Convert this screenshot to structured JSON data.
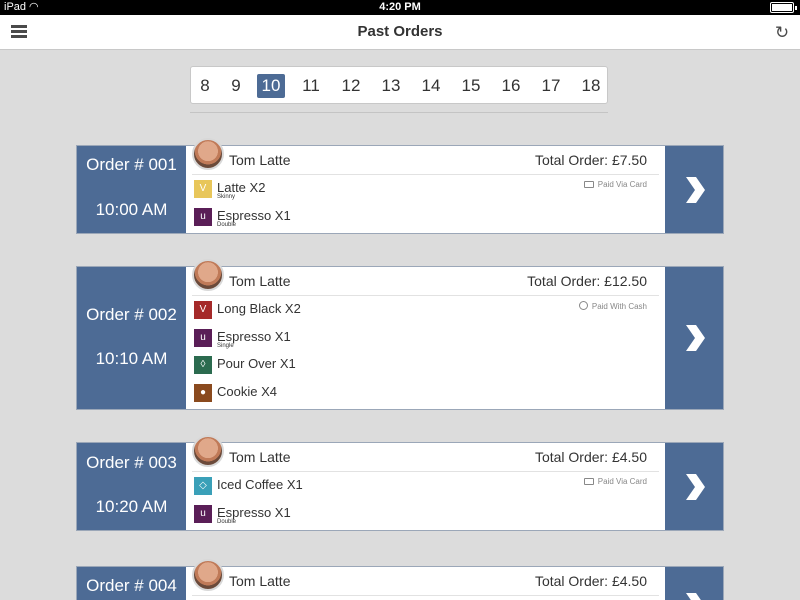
{
  "status": {
    "carrier": "iPad",
    "time": "4:20 PM"
  },
  "nav": {
    "title": "Past Orders"
  },
  "dates": [
    "8",
    "9",
    "10",
    "11",
    "12",
    "13",
    "14",
    "15",
    "16",
    "17",
    "18"
  ],
  "selected_date": "10",
  "colors": {
    "accent": "#4d6b95",
    "latte": "#e8c65a",
    "espresso": "#5a1e57",
    "long_black": "#a52a2a",
    "pour_over": "#2b6b4f",
    "cookie": "#8a4a1e",
    "iced_coffee": "#3aa0b8"
  },
  "orders": [
    {
      "number": "Order # 001",
      "time": "10:00 AM",
      "customer": "Tom Latte",
      "total": "Total Order: £7.50",
      "payment": "Paid Via Card",
      "items": [
        {
          "name": "Latte X2",
          "sub": "Skinny",
          "icon": "latte-icon"
        },
        {
          "name": "Espresso X1",
          "sub": "Double",
          "icon": "espresso-icon"
        }
      ]
    },
    {
      "number": "Order # 002",
      "time": "10:10 AM",
      "customer": "Tom Latte",
      "total": "Total Order: £12.50",
      "payment": "Paid With Cash",
      "items": [
        {
          "name": "Long Black X2",
          "sub": "",
          "icon": "long-black-icon"
        },
        {
          "name": "Espresso X1",
          "sub": "Single",
          "icon": "espresso-icon"
        },
        {
          "name": "Pour Over X1",
          "sub": "",
          "icon": "pour-over-icon"
        },
        {
          "name": "Cookie X4",
          "sub": "",
          "icon": "cookie-icon"
        }
      ]
    },
    {
      "number": "Order # 003",
      "time": "10:20 AM",
      "customer": "Tom Latte",
      "total": "Total Order: £4.50",
      "payment": "Paid Via Card",
      "items": [
        {
          "name": "Iced Coffee X1",
          "sub": "",
          "icon": "iced-coffee-icon"
        },
        {
          "name": "Espresso X1",
          "sub": "Double",
          "icon": "espresso-icon"
        }
      ]
    },
    {
      "number": "Order # 004",
      "customer": "Tom Latte",
      "total": "Total Order: £4.50"
    }
  ]
}
